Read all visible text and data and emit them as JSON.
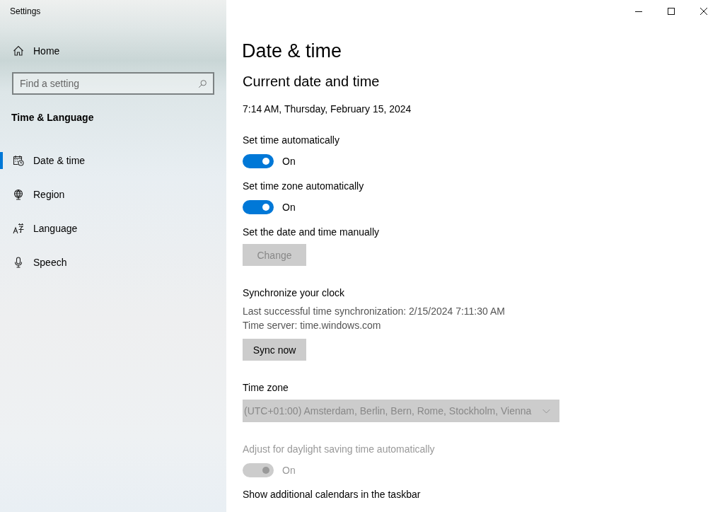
{
  "window": {
    "title": "Settings"
  },
  "sidebar": {
    "home": "Home",
    "search": {
      "placeholder": "Find a setting"
    },
    "section": "Time & Language",
    "items": [
      {
        "label": "Date & time",
        "selected": true
      },
      {
        "label": "Region",
        "selected": false
      },
      {
        "label": "Language",
        "selected": false
      },
      {
        "label": "Speech",
        "selected": false
      }
    ]
  },
  "page": {
    "title": "Date & time",
    "heading": "Current date and time",
    "current": "7:14 AM, Thursday, February 15, 2024",
    "settings": [
      {
        "kind": "toggle",
        "label": "Set time automatically",
        "on": true,
        "disabled": false,
        "state_text": "On"
      },
      {
        "kind": "toggle",
        "label": "Set time zone automatically",
        "on": true,
        "disabled": false,
        "state_text": "On"
      },
      {
        "kind": "button",
        "label": "Set the date and time manually",
        "button": "Change",
        "disabled": true
      },
      {
        "kind": "sync",
        "label": "Synchronize your clock",
        "lines": [
          "Last successful time synchronization: 2/15/2024 7:11:30 AM",
          "Time server: time.windows.com"
        ],
        "button": "Sync now",
        "disabled": false
      },
      {
        "kind": "dropdown",
        "label": "Time zone",
        "value": "(UTC+01:00) Amsterdam, Berlin, Bern, Rome, Stockholm, Vienna",
        "disabled": true
      },
      {
        "kind": "toggle",
        "label": "Adjust for daylight saving time automatically",
        "on": true,
        "disabled": true,
        "state_text": "On"
      },
      {
        "kind": "label",
        "label": "Show additional calendars in the taskbar"
      }
    ]
  }
}
